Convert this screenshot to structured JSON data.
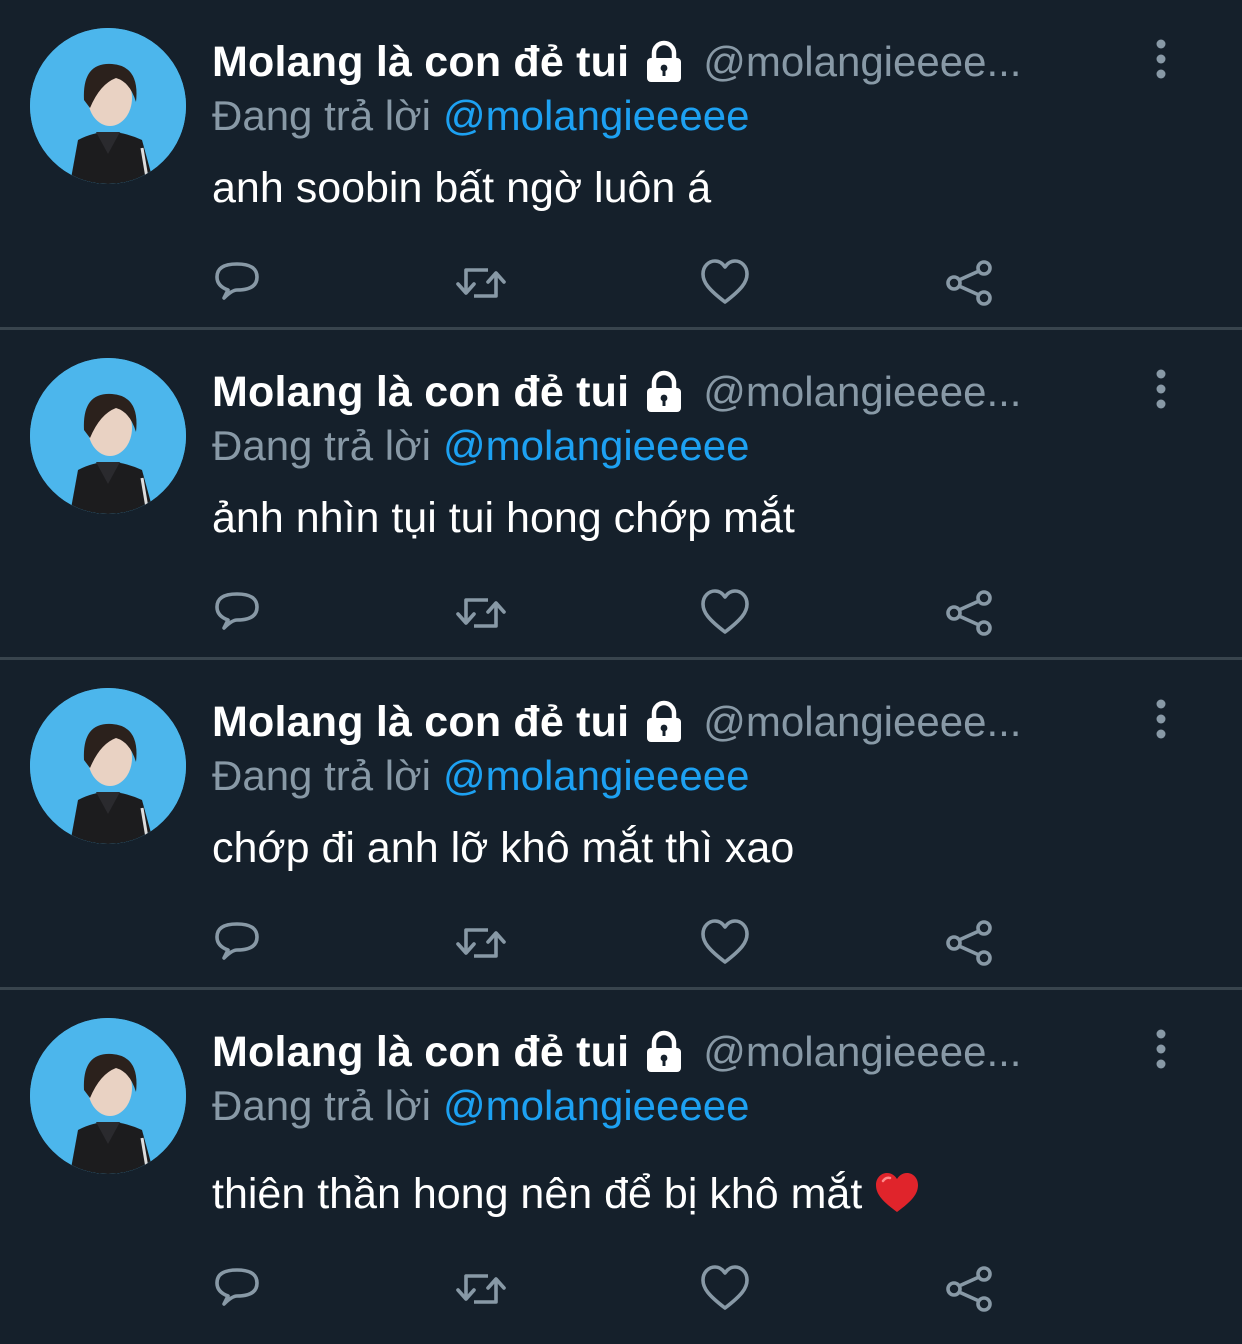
{
  "colors": {
    "background": "#15202b",
    "divider": "#38444d",
    "secondary_text": "#8899a6",
    "link": "#1da1f2",
    "avatar_bg": "#4cb6ec"
  },
  "tweets": [
    {
      "display_name": "Molang là con đẻ tui",
      "handle": "@molangieeee...",
      "reply_prefix": "Đang trả lời",
      "reply_handle": "@molangieeeee",
      "text": "anh soobin bất ngờ luôn á",
      "has_heart_emoji": false
    },
    {
      "display_name": "Molang là con đẻ tui",
      "handle": "@molangieeee...",
      "reply_prefix": "Đang trả lời",
      "reply_handle": "@molangieeeee",
      "text": "ảnh nhìn tụi tui hong chớp mắt",
      "has_heart_emoji": false
    },
    {
      "display_name": "Molang là con đẻ tui",
      "handle": "@molangieeee...",
      "reply_prefix": "Đang trả lời",
      "reply_handle": "@molangieeeee",
      "text": "chớp đi anh lỡ khô mắt thì xao",
      "has_heart_emoji": false
    },
    {
      "display_name": "Molang là con đẻ tui",
      "handle": "@molangieeee...",
      "reply_prefix": "Đang trả lời",
      "reply_handle": "@molangieeeee",
      "text": "thiên thần hong nên để bị khô mắt",
      "has_heart_emoji": true
    }
  ],
  "icons": {
    "lock": "lock-icon",
    "more": "more-vertical-icon",
    "reply": "reply-icon",
    "retweet": "retweet-icon",
    "like": "heart-icon",
    "share": "share-icon",
    "emoji": "red-heart-emoji"
  }
}
